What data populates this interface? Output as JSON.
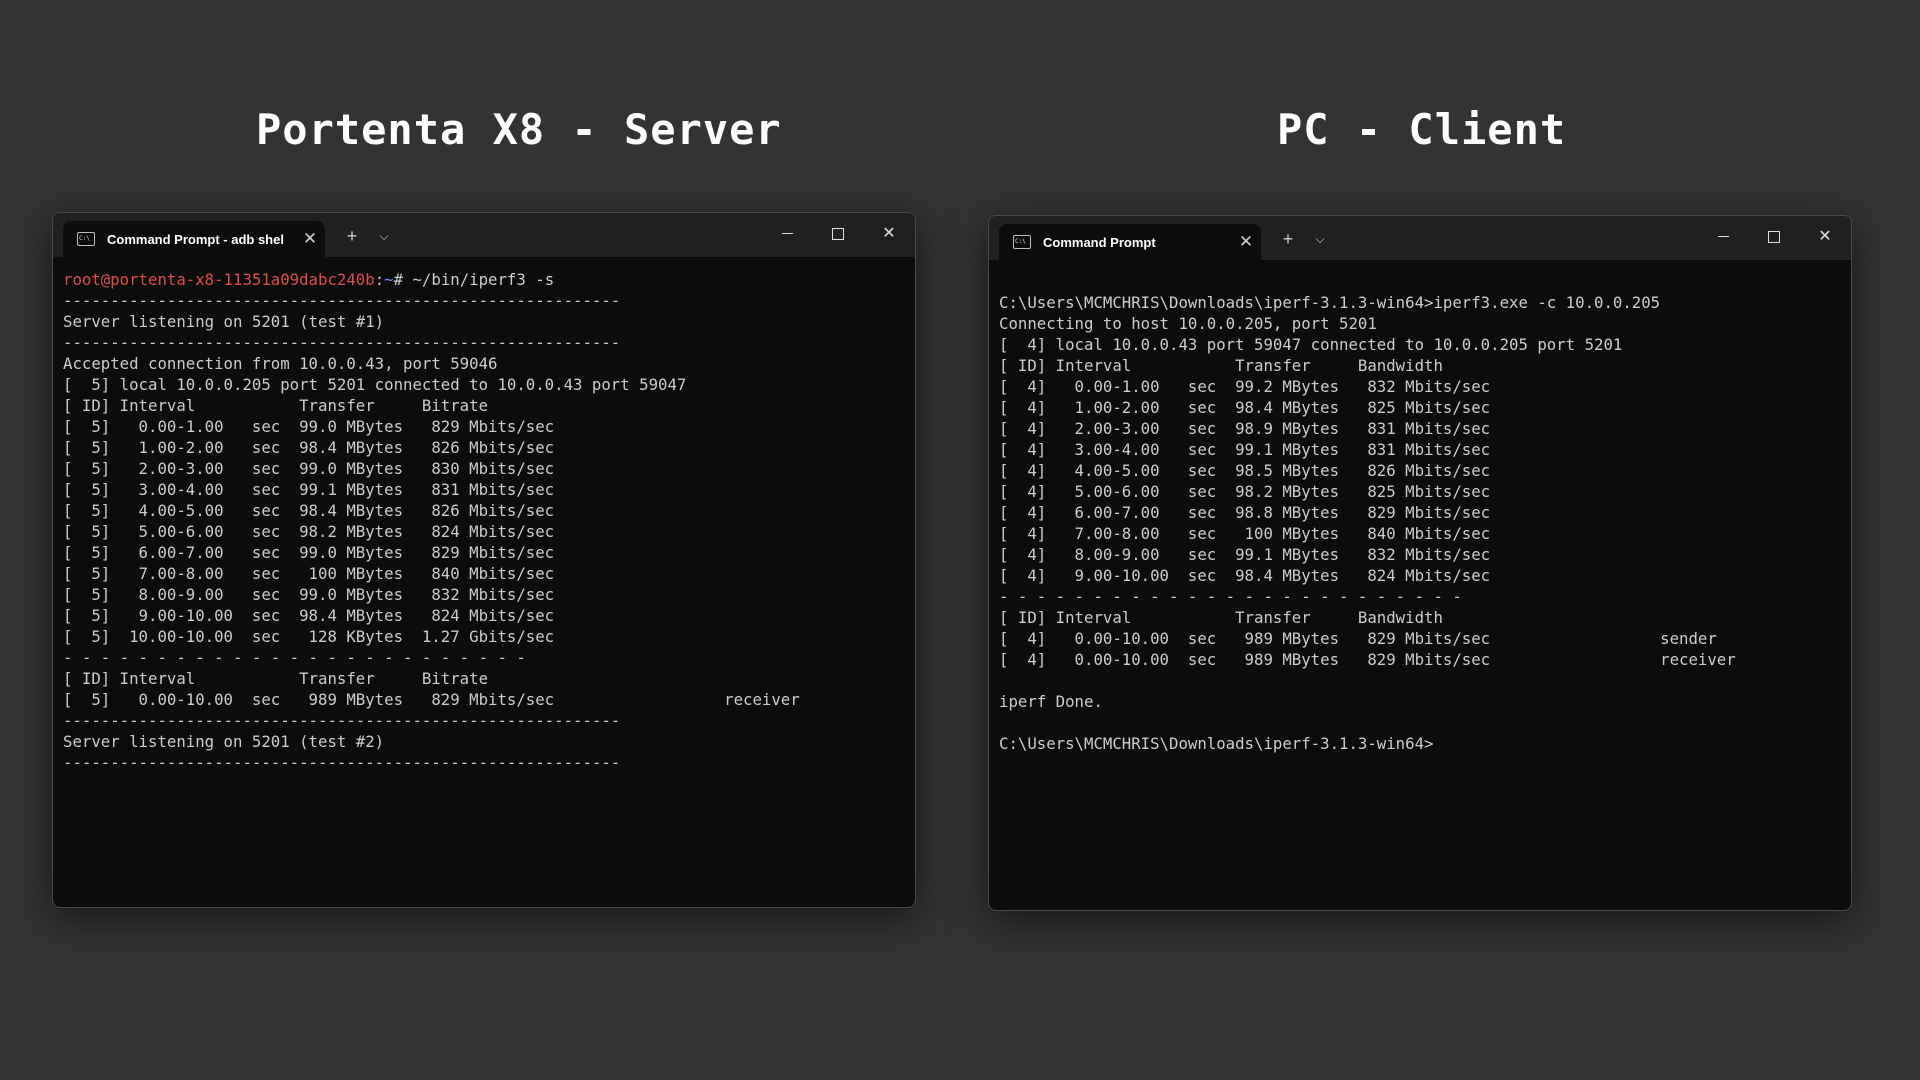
{
  "headings": {
    "left": "Portenta X8 - Server",
    "right": "PC - Client"
  },
  "server_window": {
    "tab_title": "Command Prompt - adb  shel",
    "prompt": {
      "user_host": "root@portenta-x8-11351a09dabc240b",
      "separator": ":",
      "path": "~",
      "command": "# ~/bin/iperf3 -s"
    },
    "lines": [
      "-----------------------------------------------------------",
      "Server listening on 5201 (test #1)",
      "-----------------------------------------------------------",
      "Accepted connection from 10.0.0.43, port 59046",
      "[  5] local 10.0.0.205 port 5201 connected to 10.0.0.43 port 59047",
      "[ ID] Interval           Transfer     Bitrate",
      "[  5]   0.00-1.00   sec  99.0 MBytes   829 Mbits/sec",
      "[  5]   1.00-2.00   sec  98.4 MBytes   826 Mbits/sec",
      "[  5]   2.00-3.00   sec  99.0 MBytes   830 Mbits/sec",
      "[  5]   3.00-4.00   sec  99.1 MBytes   831 Mbits/sec",
      "[  5]   4.00-5.00   sec  98.4 MBytes   826 Mbits/sec",
      "[  5]   5.00-6.00   sec  98.2 MBytes   824 Mbits/sec",
      "[  5]   6.00-7.00   sec  99.0 MBytes   829 Mbits/sec",
      "[  5]   7.00-8.00   sec   100 MBytes   840 Mbits/sec",
      "[  5]   8.00-9.00   sec  99.0 MBytes   832 Mbits/sec",
      "[  5]   9.00-10.00  sec  98.4 MBytes   824 Mbits/sec",
      "[  5]  10.00-10.00  sec   128 KBytes  1.27 Gbits/sec",
      "- - - - - - - - - - - - - - - - - - - - - - - - -",
      "[ ID] Interval           Transfer     Bitrate",
      "[  5]   0.00-10.00  sec   989 MBytes   829 Mbits/sec                  receiver",
      "-----------------------------------------------------------",
      "Server listening on 5201 (test #2)",
      "-----------------------------------------------------------"
    ]
  },
  "client_window": {
    "tab_title": "Command Prompt",
    "lines": [
      "C:\\Users\\MCMCHRIS\\Downloads\\iperf-3.1.3-win64>iperf3.exe -c 10.0.0.205",
      "Connecting to host 10.0.0.205, port 5201",
      "[  4] local 10.0.0.43 port 59047 connected to 10.0.0.205 port 5201",
      "[ ID] Interval           Transfer     Bandwidth",
      "[  4]   0.00-1.00   sec  99.2 MBytes   832 Mbits/sec",
      "[  4]   1.00-2.00   sec  98.4 MBytes   825 Mbits/sec",
      "[  4]   2.00-3.00   sec  98.9 MBytes   831 Mbits/sec",
      "[  4]   3.00-4.00   sec  99.1 MBytes   831 Mbits/sec",
      "[  4]   4.00-5.00   sec  98.5 MBytes   826 Mbits/sec",
      "[  4]   5.00-6.00   sec  98.2 MBytes   825 Mbits/sec",
      "[  4]   6.00-7.00   sec  98.8 MBytes   829 Mbits/sec",
      "[  4]   7.00-8.00   sec   100 MBytes   840 Mbits/sec",
      "[  4]   8.00-9.00   sec  99.1 MBytes   832 Mbits/sec",
      "[  4]   9.00-10.00  sec  98.4 MBytes   824 Mbits/sec",
      "- - - - - - - - - - - - - - - - - - - - - - - - -",
      "[ ID] Interval           Transfer     Bandwidth",
      "[  4]   0.00-10.00  sec   989 MBytes   829 Mbits/sec                  sender",
      "[  4]   0.00-10.00  sec   989 MBytes   829 Mbits/sec                  receiver",
      "",
      "iperf Done.",
      "",
      "C:\\Users\\MCMCHRIS\\Downloads\\iperf-3.1.3-win64>"
    ]
  },
  "controls": {
    "new_tab": "+",
    "dropdown": "⌵",
    "tab_close": "✕",
    "window_close": "✕"
  },
  "colors": {
    "background": "#333333",
    "terminal_bg": "#0c0c0c",
    "terminal_text": "#cccccc",
    "prompt_user": "#e04c4c",
    "prompt_path": "#6a8cff"
  },
  "icons": {
    "tab": "command-prompt-icon",
    "tab_close": "close-icon",
    "new_tab": "plus-icon",
    "dropdown": "chevron-down-icon",
    "minimize": "minimize-icon",
    "maximize": "maximize-icon",
    "close": "close-icon"
  }
}
